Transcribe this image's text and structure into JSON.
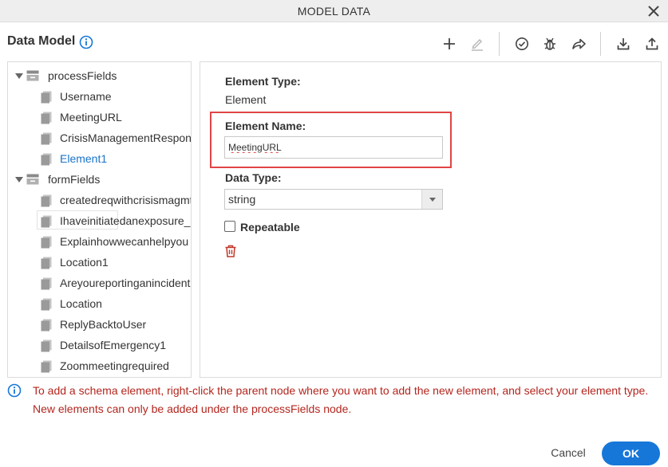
{
  "window": {
    "title": "MODEL DATA"
  },
  "header": {
    "title": "Data Model"
  },
  "tree": {
    "process_group": "processFields",
    "process_items": [
      "Username",
      "MeetingURL",
      "CrisisManagementResponse",
      "Element1"
    ],
    "form_group": "formFields",
    "form_items": [
      "createdreqwithcrisismagmt",
      "Ihaveinitiatedanexposure_",
      "Explainhowwecanhelpyou",
      "Location1",
      "Areyoureportinganincident",
      "Location",
      "ReplyBacktoUser",
      "DetailsofEmergency1",
      "Zoommeetingrequired"
    ],
    "selected": "Element1"
  },
  "details": {
    "element_type_label": "Element Type:",
    "element_type_value": "Element",
    "element_name_label": "Element Name:",
    "element_name_value": "MeetingURL",
    "data_type_label": "Data Type:",
    "data_type_value": "string",
    "repeatable_label": "Repeatable",
    "repeatable_checked": false
  },
  "hint": {
    "line1": "To add a schema element, right-click the parent node where you want to add the new element, and select your element type.",
    "line2": "New elements can only be added under the processFields node."
  },
  "footer": {
    "cancel_label": "Cancel",
    "ok_label": "OK"
  },
  "colors": {
    "primary": "#1677d9",
    "hint_text": "#b3261e",
    "highlight_border": "#e04545",
    "selected_text": "#1a73c8"
  },
  "toolbar_icons": [
    "plus-icon",
    "edit-icon",
    "check-circle-icon",
    "bug-icon",
    "share-icon",
    "download-icon",
    "upload-icon"
  ]
}
